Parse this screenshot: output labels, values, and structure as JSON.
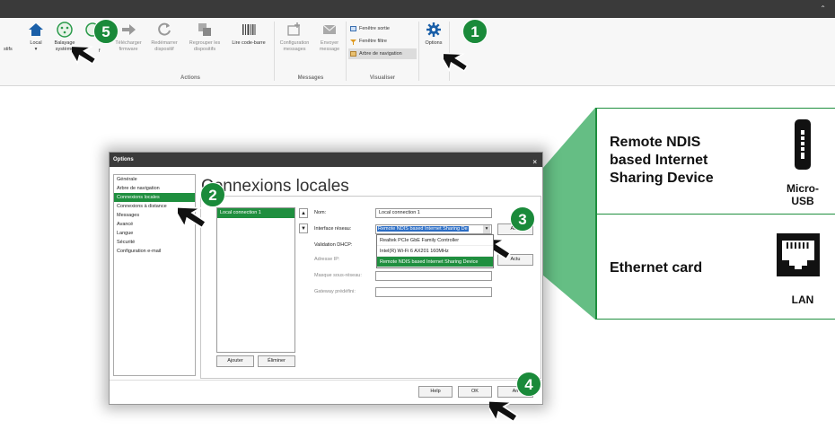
{
  "titlebar": {
    "caret": "⌃"
  },
  "ribbon": {
    "cut_left": "stifs",
    "local": "Local",
    "local_dd": "▾",
    "balayage": "Balayage\nsystème",
    "cut_f": "f",
    "telecharger": "Télécharger\nfirmware",
    "redemarrer": "Redémarrer\ndispositif",
    "regrouper": "Regrouper les\ndispositifs",
    "lire": "Lire code-barre",
    "group_actions": "Actions",
    "configuration": "Configuration\nmessages",
    "envoyer": "Envoyer\nmessage",
    "group_messages": "Messages",
    "fenetre_sortie": "Fenêtre sortie",
    "fenetre_filtre": "Fenêtre filtre",
    "arbre_nav": "Arbre de navigation",
    "group_visualiser": "Visualiser",
    "options": "Options"
  },
  "badges": {
    "b1": "1",
    "b2": "2",
    "b3": "3",
    "b4": "4",
    "b5": "5"
  },
  "dialog": {
    "title": "Options",
    "close": "×",
    "nav": [
      "Générale",
      "Arbre de navigation",
      "Connexions locales",
      "Connexions à distance",
      "Messages",
      "Avancé",
      "Langue",
      "Sécurité",
      "Configuration e-mail"
    ],
    "heading": "Connexions locales",
    "conn_item": "Local connection 1",
    "up": "▲",
    "down": "▼",
    "ajouter": "Ajouter",
    "eliminer": "Éliminer",
    "nom_label": "Nom:",
    "nom_value": "Local connection 1",
    "iface_label": "Interface réseau:",
    "iface_value": "Remote NDIS based Internet Sharing De",
    "iface_arrow": "▾",
    "dhcp_label": "Validation DHCP:",
    "ip_label": "Adresse IP:",
    "mask_label": "Masque sous-réseau:",
    "gw_label": "Gateway prédéfini:",
    "act_btn1": "Actu",
    "act_btn2": "Actu",
    "dropdown": [
      "Realtek PCIe GbE Family Controller",
      "Intel(R) Wi-Fi 6 AX201 160MHz",
      "Remote NDIS based Internet Sharing Device"
    ],
    "help": "Help",
    "ok": "OK",
    "cancel": "An"
  },
  "callout": {
    "rndis": "Remote NDIS\nbased Internet\nSharing Device",
    "micro": "Micro-\nUSB",
    "ethernet": "Ethernet card",
    "lan": "LAN"
  },
  "colors": {
    "accent": "#1f8f3f",
    "badge": "#1a8a3a",
    "callout_fill": "#5dba7d"
  }
}
